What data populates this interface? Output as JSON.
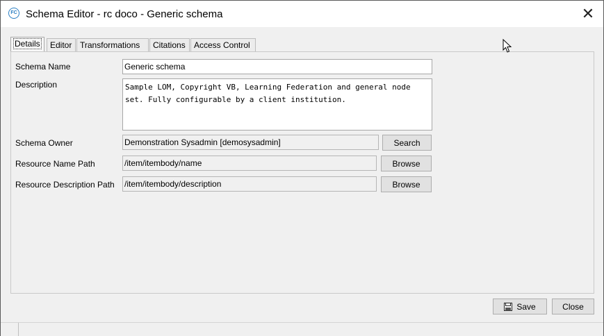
{
  "window": {
    "title": "Schema Editor - rc doco - Generic schema",
    "app_icon_text": "FC",
    "close_glyph": "✕"
  },
  "tabs": [
    {
      "label": "Details",
      "active": true
    },
    {
      "label": "Editor",
      "active": false
    },
    {
      "label": "Transformations",
      "active": false
    },
    {
      "label": "Citations",
      "active": false
    },
    {
      "label": "Access Control",
      "active": false
    }
  ],
  "form": {
    "schema_name": {
      "label": "Schema Name",
      "value": "Generic schema"
    },
    "description": {
      "label": "Description",
      "value": "Sample LOM, Copyright VB, Learning Federation and general node set. Fully configurable by a client institution."
    },
    "schema_owner": {
      "label": "Schema Owner",
      "value": "Demonstration Sysadmin [demosysadmin]",
      "button": "Search"
    },
    "resource_name_path": {
      "label": "Resource Name Path",
      "value": "/item/itembody/name",
      "button": "Browse"
    },
    "resource_description_path": {
      "label": "Resource Description Path",
      "value": "/item/itembody/description",
      "button": "Browse"
    }
  },
  "footer": {
    "save_label": "Save",
    "close_label": "Close"
  }
}
